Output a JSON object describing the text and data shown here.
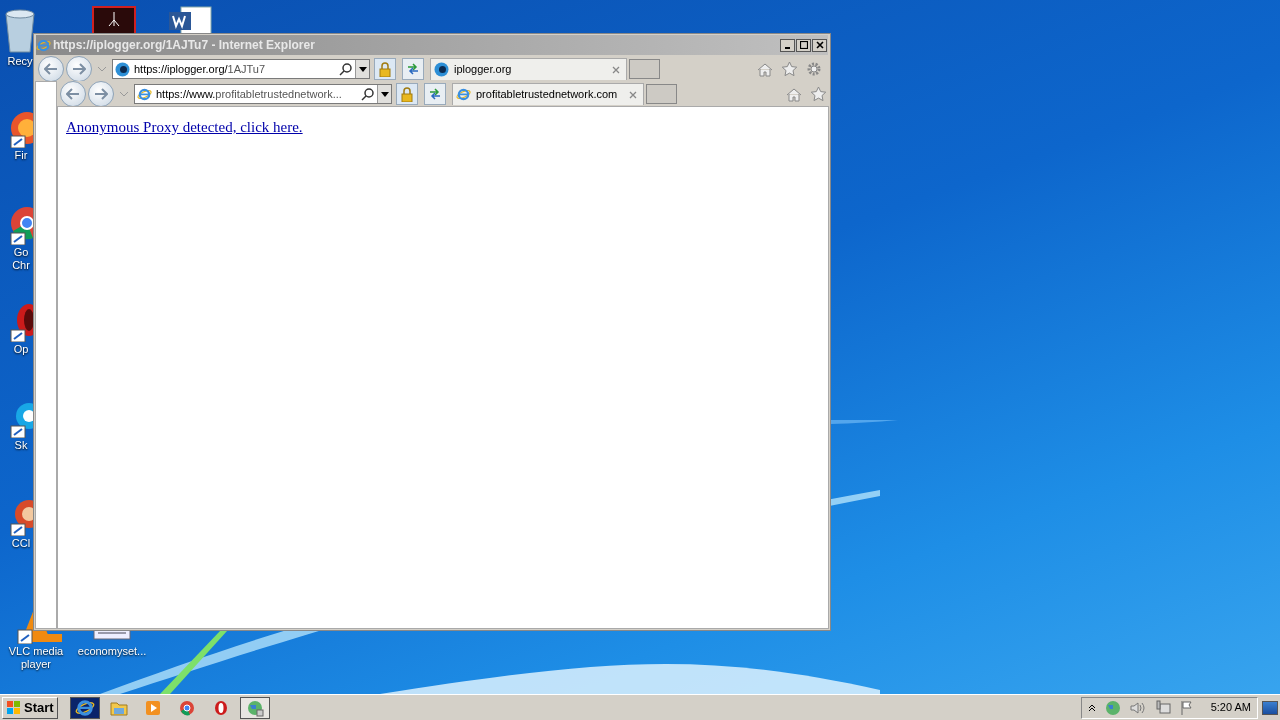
{
  "desktop_icons": [
    {
      "kind": "recycle",
      "lines": [
        "Recy"
      ]
    },
    {
      "kind": "pdf"
    },
    {
      "kind": "word"
    },
    {
      "kind": "firefox",
      "lines": [
        "Fir"
      ]
    },
    {
      "kind": "chrome",
      "lines": [
        "Go",
        "Chr"
      ]
    },
    {
      "kind": "opera",
      "lines": [
        "Op"
      ]
    },
    {
      "kind": "skype",
      "lines": [
        "Sk"
      ]
    },
    {
      "kind": "ccleaner",
      "lines": [
        "CCl"
      ]
    },
    {
      "kind": "vlc",
      "lines": [
        "VLC media",
        "player"
      ]
    },
    {
      "kind": "file",
      "lines": [
        "economyset..."
      ]
    }
  ],
  "window": {
    "title": "https://iplogger.org/1AJTu7 - Internet Explorer",
    "address": {
      "host": "https://iplogger.org/",
      "path": "1AJTu7"
    },
    "tab": {
      "label": "iplogger.org",
      "selected": true
    },
    "inner": {
      "address": {
        "host": "https://www.",
        "path": "profitabletrustednetwork..."
      },
      "tab": {
        "label": "profitabletrustednetwork.com",
        "selected": true
      },
      "link": "Anonymous Proxy detected, click here."
    }
  },
  "taskbar": {
    "start": "Start",
    "apps": [
      {
        "kind": "ie",
        "selected": true
      },
      {
        "kind": "folder",
        "selected": false
      },
      {
        "kind": "media",
        "selected": false
      },
      {
        "kind": "chrome",
        "selected": false
      },
      {
        "kind": "opera",
        "selected": false
      },
      {
        "kind": "globe",
        "selected": true
      }
    ],
    "clock": "5:20 AM"
  }
}
